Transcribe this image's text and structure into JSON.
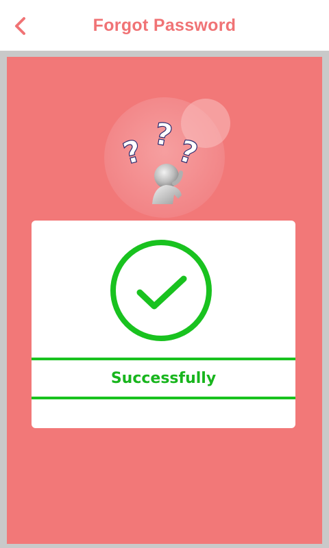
{
  "header": {
    "title": "Forgot Password",
    "back_icon": "chevron-left-icon"
  },
  "illustration": {
    "icon": "confused-person-question-marks-icon",
    "question_marks": [
      "?",
      "?",
      "?"
    ]
  },
  "result": {
    "icon": "success-check-icon",
    "status": "Successfully"
  },
  "colors": {
    "accent": "#f07375",
    "panel": "#f27878",
    "success": "#19c21f",
    "frame": "#c9c9c9",
    "card": "#ffffff"
  }
}
